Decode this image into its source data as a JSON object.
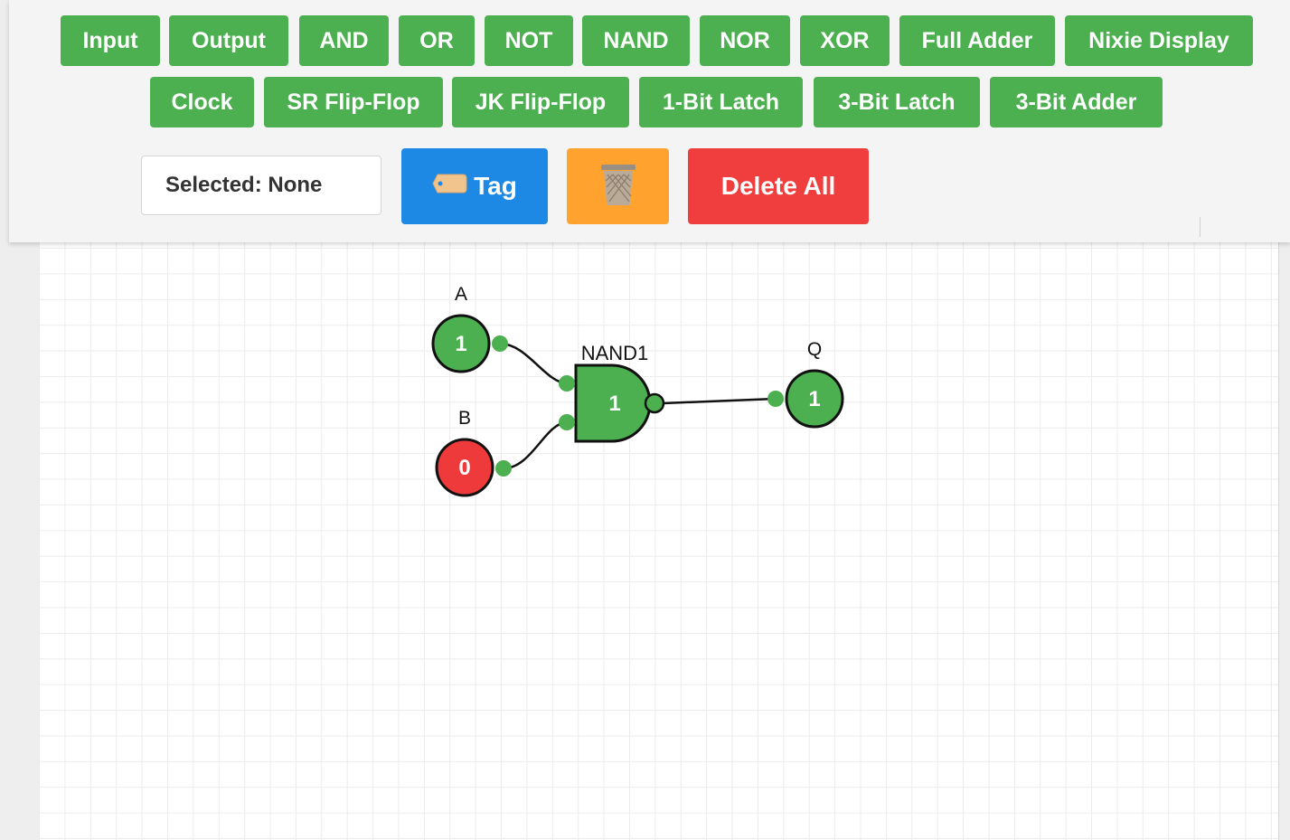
{
  "toolbar": {
    "row1": [
      "Input",
      "Output",
      "AND",
      "OR",
      "NOT",
      "NAND",
      "NOR",
      "XOR",
      "Full Adder",
      "Nixie Display"
    ],
    "row2": [
      "Clock",
      "SR Flip-Flop",
      "JK Flip-Flop",
      "1-Bit Latch",
      "3-Bit Latch",
      "3-Bit Adder"
    ],
    "selected_label": "Selected: None",
    "tag_label": "Tag",
    "tag_icon": "tag-icon",
    "trash_icon": "trash-icon",
    "delete_all_label": "Delete All"
  },
  "colors": {
    "button_green": "#4caf50",
    "tag_blue": "#1e88e5",
    "trash_orange": "#ffa22e",
    "delete_red": "#f03e3e",
    "node_on": "#4caf50",
    "node_off": "#ee3a3a"
  },
  "circuit": {
    "input_a": {
      "label": "A",
      "value": "1"
    },
    "input_b": {
      "label": "B",
      "value": "0"
    },
    "gate": {
      "label": "NAND1",
      "value": "1"
    },
    "output_q": {
      "label": "Q",
      "value": "1"
    }
  }
}
